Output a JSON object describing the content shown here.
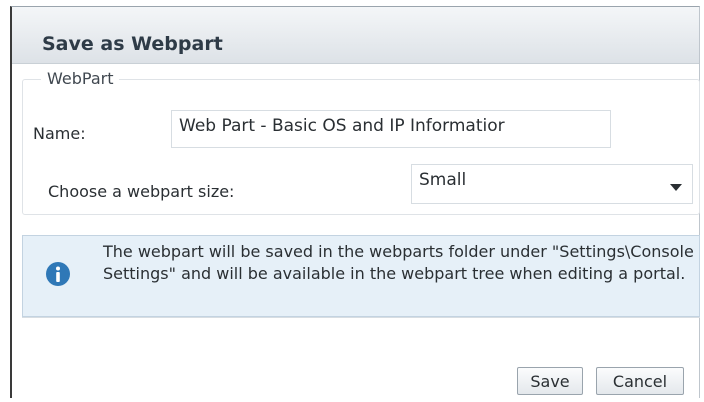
{
  "dialog": {
    "title": "Save as Webpart"
  },
  "fieldset": {
    "legend": "WebPart",
    "name_label": "Name:",
    "name_value": "Web Part - Basic OS and IP Informatior",
    "size_label": "Choose a webpart size:",
    "size_value": "Small"
  },
  "info": {
    "icon": "info-icon",
    "text": "The webpart will be saved in the webparts folder under \"Settings\\Console Settings\" and will be available in the webpart tree when editing a portal."
  },
  "buttons": {
    "save": "Save",
    "cancel": "Cancel"
  },
  "colors": {
    "info_background": "#e6f0f8",
    "info_icon": "#2f78b7"
  }
}
